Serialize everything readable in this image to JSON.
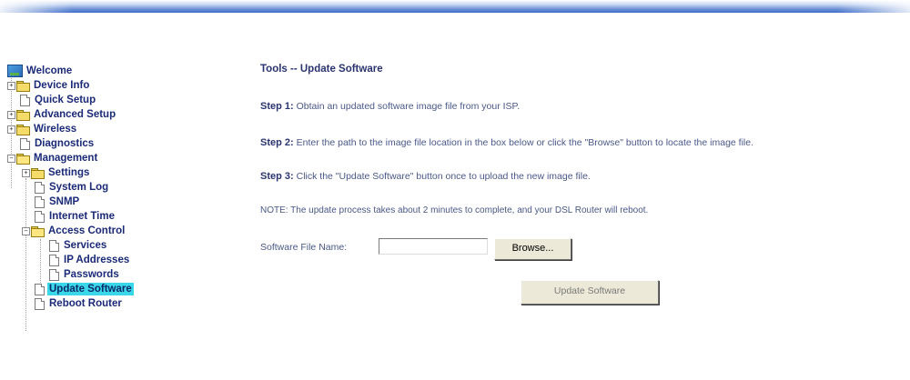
{
  "nav": {
    "root": "Welcome",
    "items": [
      {
        "label": "Device Info"
      },
      {
        "label": "Quick Setup"
      },
      {
        "label": "Advanced Setup"
      },
      {
        "label": "Wireless"
      },
      {
        "label": "Diagnostics"
      },
      {
        "label": "Management"
      },
      {
        "label": "Settings"
      },
      {
        "label": "System Log"
      },
      {
        "label": "SNMP"
      },
      {
        "label": "Internet Time"
      },
      {
        "label": "Access Control"
      },
      {
        "label": "Services"
      },
      {
        "label": "IP Addresses"
      },
      {
        "label": "Passwords"
      },
      {
        "label": "Update Software"
      },
      {
        "label": "Reboot Router"
      }
    ],
    "selected": "Update Software"
  },
  "main": {
    "title": "Tools -- Update Software",
    "steps": [
      {
        "label": "Step 1:",
        "text": " Obtain an updated software image file from your ISP."
      },
      {
        "label": "Step 2:",
        "text": " Enter the path to the image file location in the box below or click the \"Browse\" button to locate the image file."
      },
      {
        "label": "Step 3:",
        "text": " Click the \"Update Software\" button once to upload the new image file."
      }
    ],
    "note": "NOTE: The update process takes about 2 minutes to complete, and your DSL Router will reboot.",
    "file_label": "Software File Name:",
    "file_value": "",
    "browse_label": "Browse...",
    "update_label": "Update Software"
  },
  "colors": {
    "selected_highlight": "#3ad7e8",
    "nav_text": "#1a2a78",
    "top_bar": "#3f6fc8"
  }
}
